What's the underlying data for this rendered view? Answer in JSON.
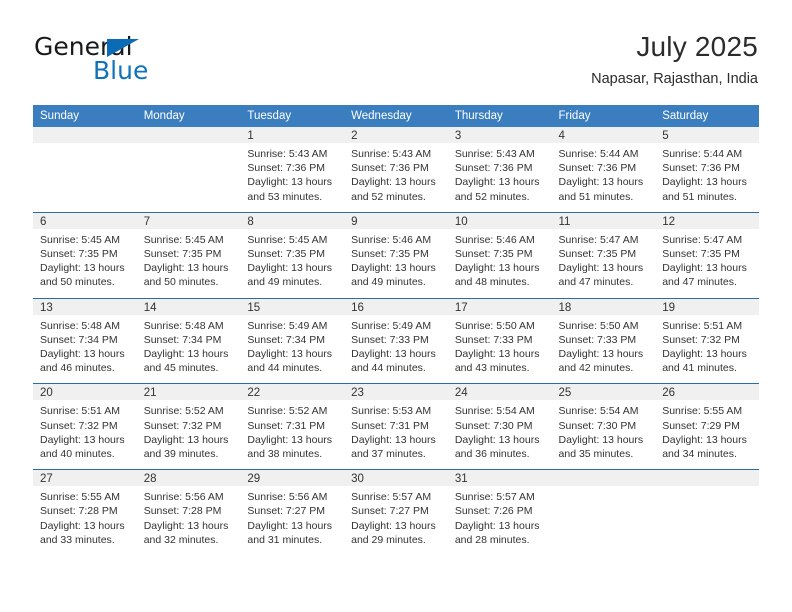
{
  "brand": {
    "name_top": "General",
    "name_bottom": "Blue",
    "color_blue": "#1273ba",
    "triangle_color": "#0b6cb5"
  },
  "header": {
    "title": "July 2025",
    "subtitle": "Napasar, Rajasthan, India"
  },
  "theme": {
    "header_blue": "#3b7ebf",
    "row_divider_blue": "#2b6ca8",
    "daynum_band": "#f0f0f0",
    "text": "#333333"
  },
  "weekdays": [
    "Sunday",
    "Monday",
    "Tuesday",
    "Wednesday",
    "Thursday",
    "Friday",
    "Saturday"
  ],
  "weeks": [
    [
      {
        "empty": true
      },
      {
        "empty": true
      },
      {
        "day": "1",
        "sunrise": "Sunrise: 5:43 AM",
        "sunset": "Sunset: 7:36 PM",
        "daylight1": "Daylight: 13 hours",
        "daylight2": "and 53 minutes."
      },
      {
        "day": "2",
        "sunrise": "Sunrise: 5:43 AM",
        "sunset": "Sunset: 7:36 PM",
        "daylight1": "Daylight: 13 hours",
        "daylight2": "and 52 minutes."
      },
      {
        "day": "3",
        "sunrise": "Sunrise: 5:43 AM",
        "sunset": "Sunset: 7:36 PM",
        "daylight1": "Daylight: 13 hours",
        "daylight2": "and 52 minutes."
      },
      {
        "day": "4",
        "sunrise": "Sunrise: 5:44 AM",
        "sunset": "Sunset: 7:36 PM",
        "daylight1": "Daylight: 13 hours",
        "daylight2": "and 51 minutes."
      },
      {
        "day": "5",
        "sunrise": "Sunrise: 5:44 AM",
        "sunset": "Sunset: 7:36 PM",
        "daylight1": "Daylight: 13 hours",
        "daylight2": "and 51 minutes."
      }
    ],
    [
      {
        "day": "6",
        "sunrise": "Sunrise: 5:45 AM",
        "sunset": "Sunset: 7:35 PM",
        "daylight1": "Daylight: 13 hours",
        "daylight2": "and 50 minutes."
      },
      {
        "day": "7",
        "sunrise": "Sunrise: 5:45 AM",
        "sunset": "Sunset: 7:35 PM",
        "daylight1": "Daylight: 13 hours",
        "daylight2": "and 50 minutes."
      },
      {
        "day": "8",
        "sunrise": "Sunrise: 5:45 AM",
        "sunset": "Sunset: 7:35 PM",
        "daylight1": "Daylight: 13 hours",
        "daylight2": "and 49 minutes."
      },
      {
        "day": "9",
        "sunrise": "Sunrise: 5:46 AM",
        "sunset": "Sunset: 7:35 PM",
        "daylight1": "Daylight: 13 hours",
        "daylight2": "and 49 minutes."
      },
      {
        "day": "10",
        "sunrise": "Sunrise: 5:46 AM",
        "sunset": "Sunset: 7:35 PM",
        "daylight1": "Daylight: 13 hours",
        "daylight2": "and 48 minutes."
      },
      {
        "day": "11",
        "sunrise": "Sunrise: 5:47 AM",
        "sunset": "Sunset: 7:35 PM",
        "daylight1": "Daylight: 13 hours",
        "daylight2": "and 47 minutes."
      },
      {
        "day": "12",
        "sunrise": "Sunrise: 5:47 AM",
        "sunset": "Sunset: 7:35 PM",
        "daylight1": "Daylight: 13 hours",
        "daylight2": "and 47 minutes."
      }
    ],
    [
      {
        "day": "13",
        "sunrise": "Sunrise: 5:48 AM",
        "sunset": "Sunset: 7:34 PM",
        "daylight1": "Daylight: 13 hours",
        "daylight2": "and 46 minutes."
      },
      {
        "day": "14",
        "sunrise": "Sunrise: 5:48 AM",
        "sunset": "Sunset: 7:34 PM",
        "daylight1": "Daylight: 13 hours",
        "daylight2": "and 45 minutes."
      },
      {
        "day": "15",
        "sunrise": "Sunrise: 5:49 AM",
        "sunset": "Sunset: 7:34 PM",
        "daylight1": "Daylight: 13 hours",
        "daylight2": "and 44 minutes."
      },
      {
        "day": "16",
        "sunrise": "Sunrise: 5:49 AM",
        "sunset": "Sunset: 7:33 PM",
        "daylight1": "Daylight: 13 hours",
        "daylight2": "and 44 minutes."
      },
      {
        "day": "17",
        "sunrise": "Sunrise: 5:50 AM",
        "sunset": "Sunset: 7:33 PM",
        "daylight1": "Daylight: 13 hours",
        "daylight2": "and 43 minutes."
      },
      {
        "day": "18",
        "sunrise": "Sunrise: 5:50 AM",
        "sunset": "Sunset: 7:33 PM",
        "daylight1": "Daylight: 13 hours",
        "daylight2": "and 42 minutes."
      },
      {
        "day": "19",
        "sunrise": "Sunrise: 5:51 AM",
        "sunset": "Sunset: 7:32 PM",
        "daylight1": "Daylight: 13 hours",
        "daylight2": "and 41 minutes."
      }
    ],
    [
      {
        "day": "20",
        "sunrise": "Sunrise: 5:51 AM",
        "sunset": "Sunset: 7:32 PM",
        "daylight1": "Daylight: 13 hours",
        "daylight2": "and 40 minutes."
      },
      {
        "day": "21",
        "sunrise": "Sunrise: 5:52 AM",
        "sunset": "Sunset: 7:32 PM",
        "daylight1": "Daylight: 13 hours",
        "daylight2": "and 39 minutes."
      },
      {
        "day": "22",
        "sunrise": "Sunrise: 5:52 AM",
        "sunset": "Sunset: 7:31 PM",
        "daylight1": "Daylight: 13 hours",
        "daylight2": "and 38 minutes."
      },
      {
        "day": "23",
        "sunrise": "Sunrise: 5:53 AM",
        "sunset": "Sunset: 7:31 PM",
        "daylight1": "Daylight: 13 hours",
        "daylight2": "and 37 minutes."
      },
      {
        "day": "24",
        "sunrise": "Sunrise: 5:54 AM",
        "sunset": "Sunset: 7:30 PM",
        "daylight1": "Daylight: 13 hours",
        "daylight2": "and 36 minutes."
      },
      {
        "day": "25",
        "sunrise": "Sunrise: 5:54 AM",
        "sunset": "Sunset: 7:30 PM",
        "daylight1": "Daylight: 13 hours",
        "daylight2": "and 35 minutes."
      },
      {
        "day": "26",
        "sunrise": "Sunrise: 5:55 AM",
        "sunset": "Sunset: 7:29 PM",
        "daylight1": "Daylight: 13 hours",
        "daylight2": "and 34 minutes."
      }
    ],
    [
      {
        "day": "27",
        "sunrise": "Sunrise: 5:55 AM",
        "sunset": "Sunset: 7:28 PM",
        "daylight1": "Daylight: 13 hours",
        "daylight2": "and 33 minutes."
      },
      {
        "day": "28",
        "sunrise": "Sunrise: 5:56 AM",
        "sunset": "Sunset: 7:28 PM",
        "daylight1": "Daylight: 13 hours",
        "daylight2": "and 32 minutes."
      },
      {
        "day": "29",
        "sunrise": "Sunrise: 5:56 AM",
        "sunset": "Sunset: 7:27 PM",
        "daylight1": "Daylight: 13 hours",
        "daylight2": "and 31 minutes."
      },
      {
        "day": "30",
        "sunrise": "Sunrise: 5:57 AM",
        "sunset": "Sunset: 7:27 PM",
        "daylight1": "Daylight: 13 hours",
        "daylight2": "and 29 minutes."
      },
      {
        "day": "31",
        "sunrise": "Sunrise: 5:57 AM",
        "sunset": "Sunset: 7:26 PM",
        "daylight1": "Daylight: 13 hours",
        "daylight2": "and 28 minutes."
      },
      {
        "empty": true
      },
      {
        "empty": true
      }
    ]
  ]
}
